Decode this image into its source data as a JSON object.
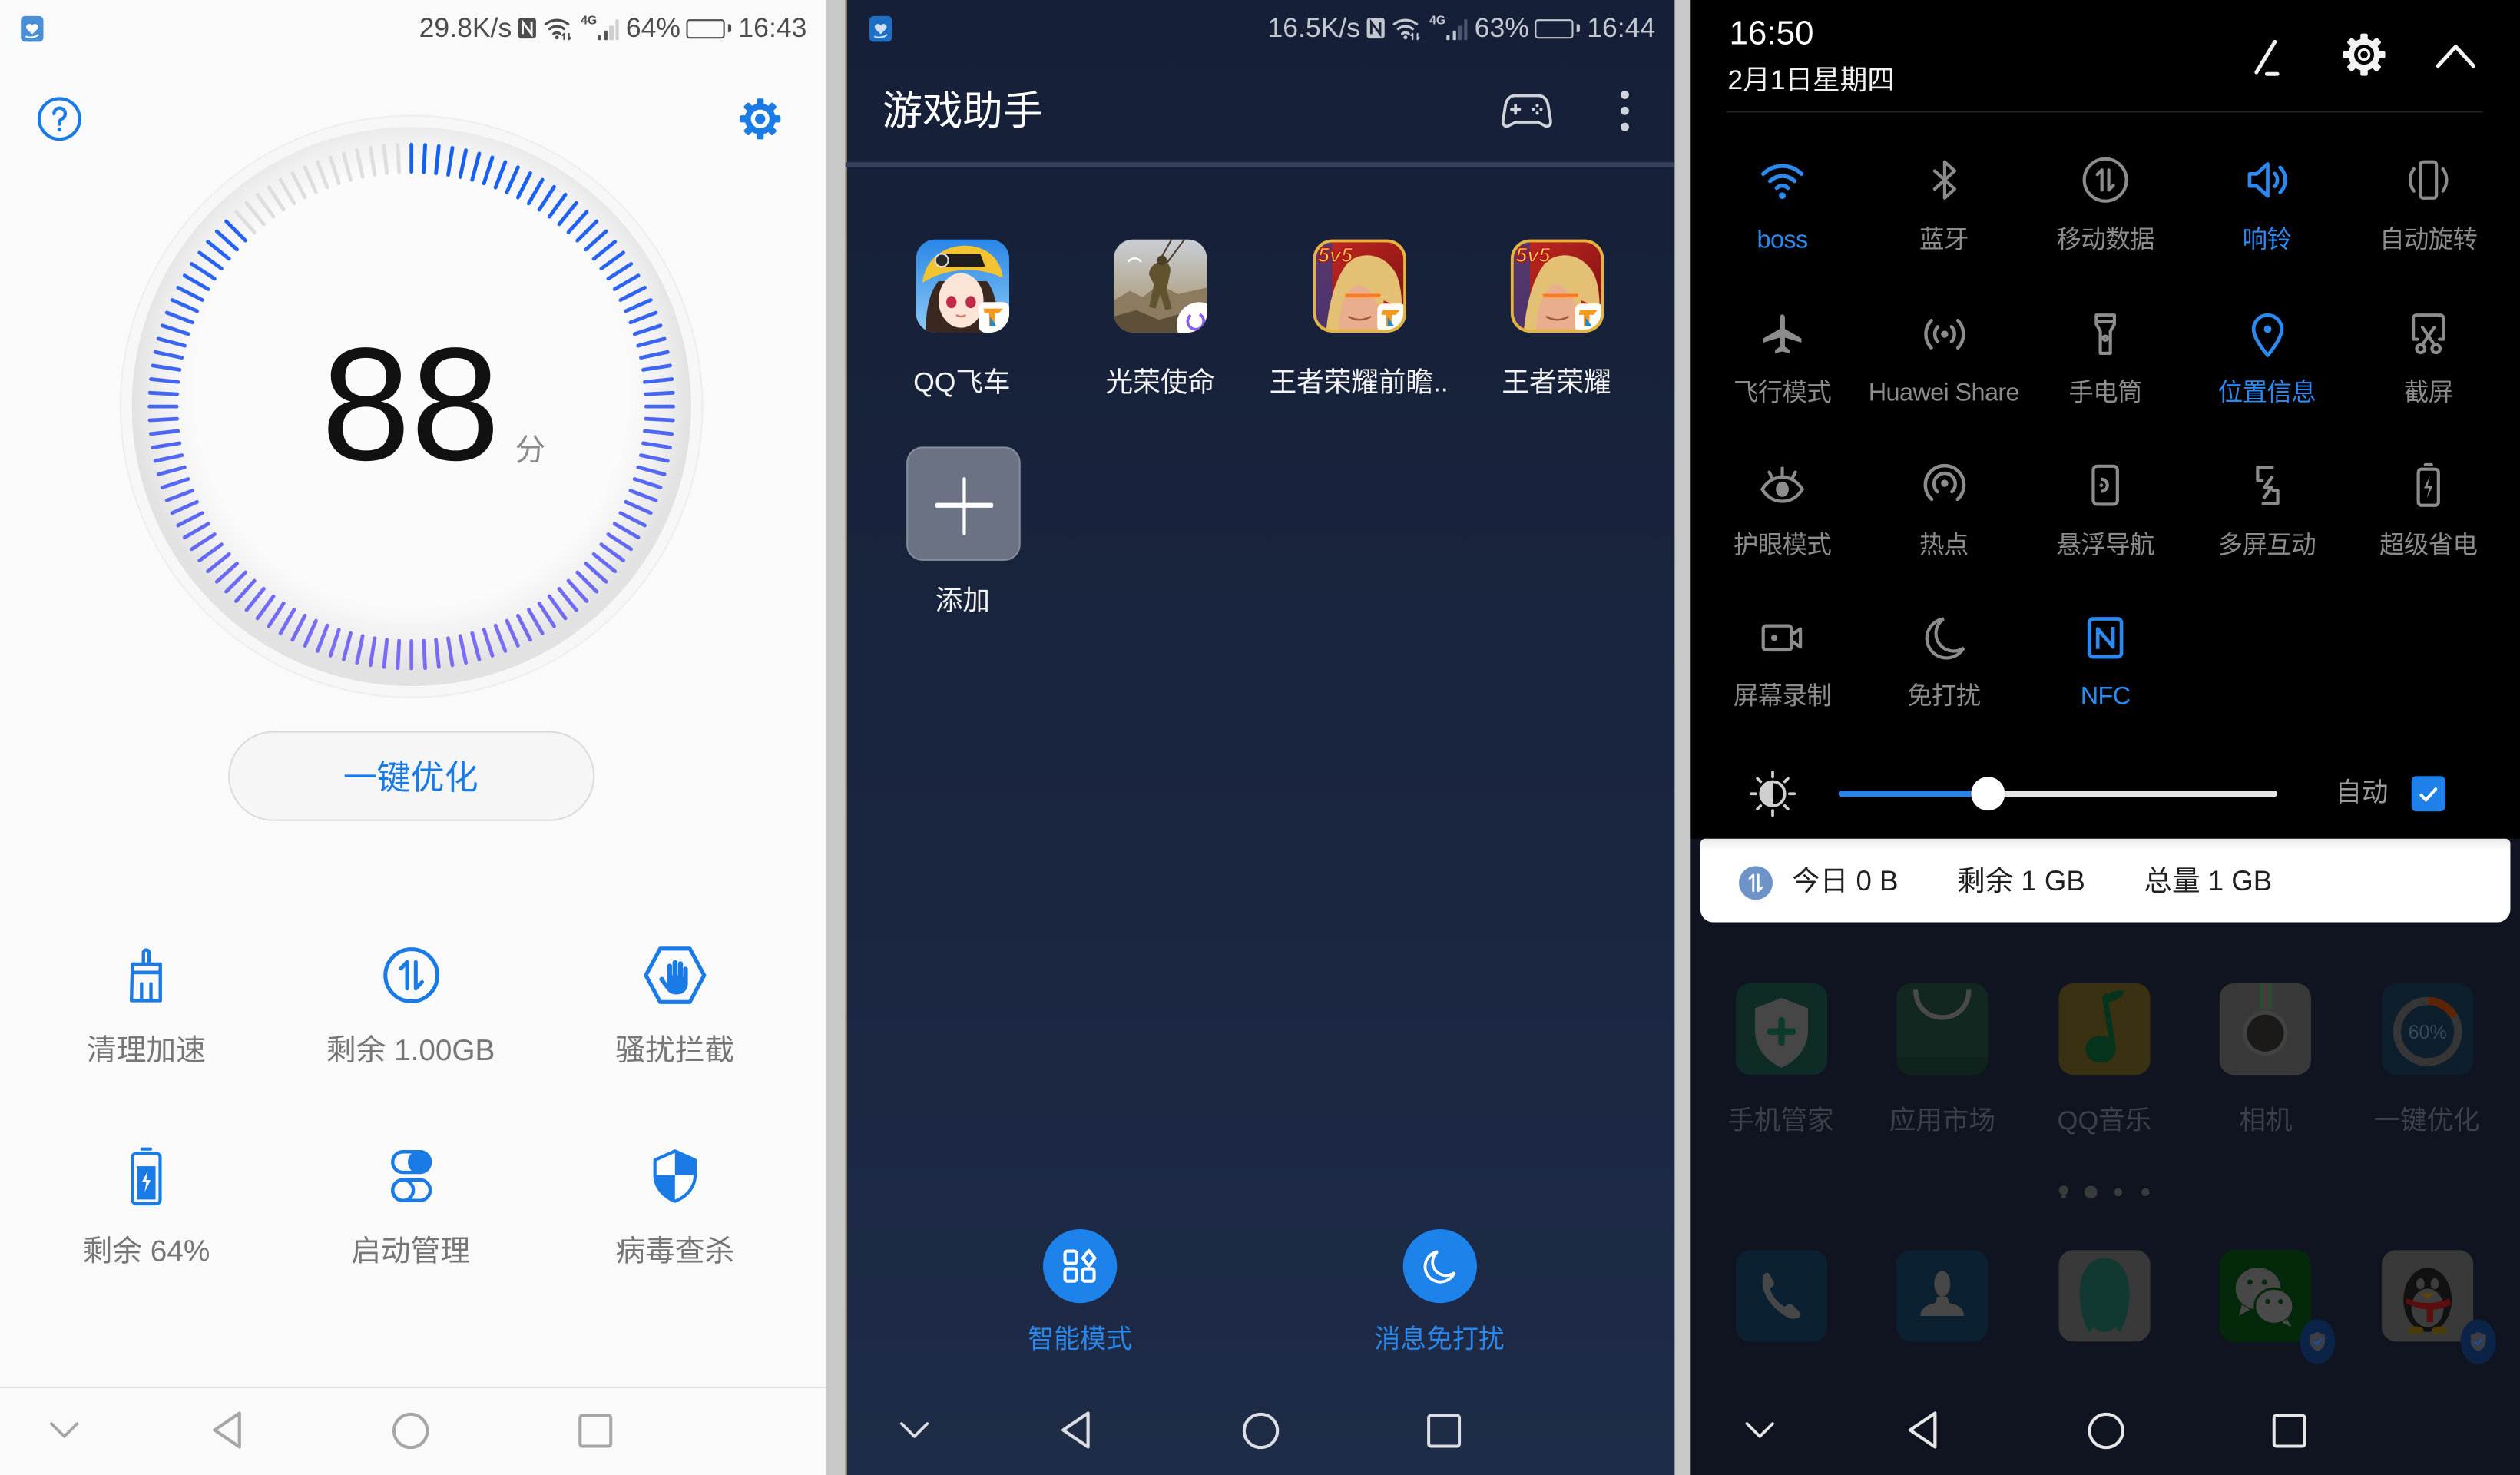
{
  "phone_manager": {
    "status_bar": {
      "notification_icon": "phone-manager-notification-icon",
      "net_speed": "29.8K/s",
      "network_type": "4G",
      "signal_bars": 2,
      "battery_text": "64%",
      "battery_level": 0.64,
      "time": "16:43"
    },
    "help_icon": "help-circle-icon",
    "settings_icon": "gear-icon",
    "score": 88,
    "score_unit": "分",
    "optimize_button": "一键优化",
    "tools": [
      {
        "label": "清理加速",
        "icon": "broom-icon"
      },
      {
        "label": "剩余 1.00GB",
        "icon": "data-traffic-icon"
      },
      {
        "label": "骚扰拦截",
        "icon": "block-hand-icon"
      },
      {
        "label": "剩余 64%",
        "icon": "battery-charging-icon"
      },
      {
        "label": "启动管理",
        "icon": "startup-toggle-icon"
      },
      {
        "label": "病毒查杀",
        "icon": "shield-icon"
      }
    ],
    "nav_bar": [
      "chevron-down-icon",
      "back-icon",
      "home-icon",
      "recents-icon"
    ],
    "colors": {
      "accent": "#1a7be6",
      "gauge_start": "#1460f2",
      "gauge_end": "#7a6cf2",
      "gauge_empty": "#dedede"
    }
  },
  "game_assistant": {
    "status_bar": {
      "notification_icon": "phone-manager-notification-icon",
      "net_speed": "16.5K/s",
      "network_type": "4G",
      "signal_bars": 2,
      "battery_text": "63%",
      "battery_level": 0.63,
      "time": "16:44"
    },
    "title": "游戏助手",
    "header_icons": [
      "gamepad-icon",
      "more-vertical-icon"
    ],
    "games": [
      {
        "name": "QQ飞车",
        "icon": "qq-speed-game-icon"
      },
      {
        "name": "光荣使命",
        "icon": "glorious-mission-game-icon"
      },
      {
        "name": "王者荣耀前瞻..",
        "icon": "honor-of-kings-preview-game-icon",
        "badge": "5v5"
      },
      {
        "name": "王者荣耀",
        "icon": "honor-of-kings-game-icon",
        "badge": "5v5"
      }
    ],
    "add_label": "添加",
    "actions": [
      {
        "label": "智能模式",
        "icon": "smart-mode-icon"
      },
      {
        "label": "消息免打扰",
        "icon": "moon-icon"
      }
    ],
    "nav_bar": [
      "chevron-down-icon",
      "back-icon",
      "home-icon",
      "recents-icon"
    ],
    "colors": {
      "background": "#172139",
      "accent": "#1d82ea"
    }
  },
  "quick_settings": {
    "time": "16:50",
    "date": "2月1日星期四",
    "header_icons": [
      "edit-icon",
      "gear-icon",
      "chevron-up-icon"
    ],
    "toggles": [
      {
        "label": "boss",
        "icon": "wifi-icon",
        "active": true
      },
      {
        "label": "蓝牙",
        "icon": "bluetooth-icon",
        "active": false
      },
      {
        "label": "移动数据",
        "icon": "mobile-data-icon",
        "active": false
      },
      {
        "label": "响铃",
        "icon": "ring-volume-icon",
        "active": true
      },
      {
        "label": "自动旋转",
        "icon": "auto-rotate-icon",
        "active": false
      },
      {
        "label": "飞行模式",
        "icon": "airplane-icon",
        "active": false
      },
      {
        "label": "Huawei Share",
        "icon": "huawei-share-icon",
        "active": false
      },
      {
        "label": "手电筒",
        "icon": "flashlight-icon",
        "active": false
      },
      {
        "label": "位置信息",
        "icon": "location-icon",
        "active": true
      },
      {
        "label": "截屏",
        "icon": "screenshot-icon",
        "active": false
      },
      {
        "label": "护眼模式",
        "icon": "eye-comfort-icon",
        "active": false
      },
      {
        "label": "热点",
        "icon": "hotspot-icon",
        "active": false
      },
      {
        "label": "悬浮导航",
        "icon": "floating-nav-icon",
        "active": false
      },
      {
        "label": "多屏互动",
        "icon": "multi-screen-icon",
        "active": false
      },
      {
        "label": "超级省电",
        "icon": "power-saving-icon",
        "active": false
      },
      {
        "label": "屏幕录制",
        "icon": "screen-record-icon",
        "active": false
      },
      {
        "label": "免打扰",
        "icon": "do-not-disturb-icon",
        "active": false
      },
      {
        "label": "NFC",
        "icon": "nfc-icon",
        "active": true
      }
    ],
    "brightness": {
      "level": 0.34,
      "auto_label": "自动",
      "auto_checked": true
    },
    "data_usage": {
      "today": "今日 0 B",
      "remaining": "剩余 1 GB",
      "total": "总量 1 GB"
    },
    "home_apps": [
      {
        "label": "手机管家",
        "icon": "phone-manager-app-icon"
      },
      {
        "label": "应用市场",
        "icon": "app-market-icon"
      },
      {
        "label": "QQ音乐",
        "icon": "qq-music-icon"
      },
      {
        "label": "相机",
        "icon": "camera-app-icon"
      },
      {
        "label": "一键优化",
        "icon": "optimize-app-icon",
        "badge": "60%"
      }
    ],
    "page_indicator": {
      "has_feed_page": true,
      "count": 3,
      "active_index": 0
    },
    "dock_apps": [
      {
        "icon": "phone-app-icon",
        "protected": false
      },
      {
        "icon": "contacts-app-icon",
        "protected": false
      },
      {
        "icon": "messages-app-icon",
        "protected": false
      },
      {
        "icon": "wechat-app-icon",
        "protected": true
      },
      {
        "icon": "qq-app-icon",
        "protected": true
      }
    ],
    "nav_bar": [
      "chevron-down-icon",
      "back-icon",
      "home-icon",
      "recents-icon"
    ],
    "colors": {
      "active": "#2a8af0",
      "inactive": "#8c8c8c",
      "shade": "#000000"
    }
  }
}
